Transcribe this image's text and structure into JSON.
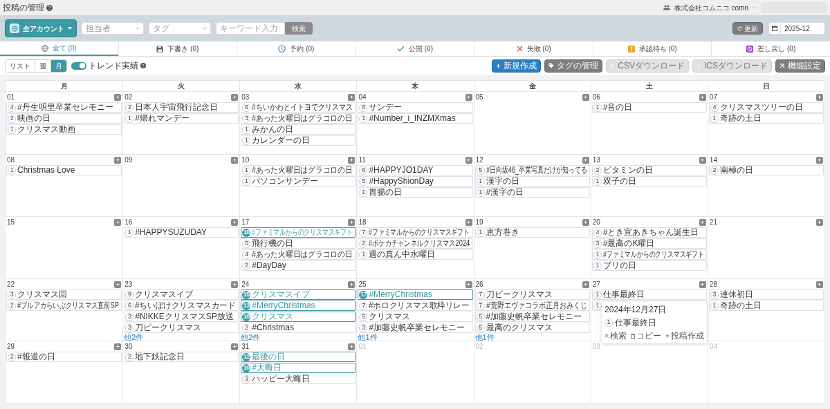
{
  "header": {
    "title": "投稿の管理",
    "company": "株式会社コムニコ comn"
  },
  "toolbar": {
    "account_button": "全アカウント",
    "filters": [
      {
        "placeholder": "担当者"
      },
      {
        "placeholder": "タグ"
      }
    ],
    "keyword": {
      "placeholder": "キーワード入力"
    },
    "search_button": "検索",
    "refresh_button": "更新",
    "month": {
      "value": "2025-12"
    }
  },
  "tabs": [
    {
      "kind": "all",
      "label": "全て (0)",
      "selected": true
    },
    {
      "kind": "draft",
      "label": "下書き (0)",
      "selected": false
    },
    {
      "kind": "scheduled",
      "label": "予約 (0)",
      "selected": false
    },
    {
      "kind": "published",
      "label": "公開 (0)",
      "selected": false
    },
    {
      "kind": "failed",
      "label": "失敗 (0)",
      "selected": false
    },
    {
      "kind": "pending",
      "label": "承認待ち (0)",
      "selected": false
    },
    {
      "kind": "returned",
      "label": "差し戻し (0)",
      "selected": false
    }
  ],
  "views": [
    {
      "label": "リスト",
      "selected": false
    },
    {
      "label": "週",
      "selected": false
    },
    {
      "label": "月",
      "selected": true
    }
  ],
  "trend_toggle": {
    "label": "トレンド実績",
    "on": true
  },
  "actions": [
    {
      "kind": "new",
      "label": "新規作成",
      "disabled": false
    },
    {
      "kind": "tag",
      "label": "タグの管理",
      "disabled": false
    },
    {
      "kind": "download",
      "label": "CSVダウンロード",
      "disabled": true
    },
    {
      "kind": "download",
      "label": "ICSダウンロード",
      "disabled": true
    },
    {
      "kind": "settings",
      "label": "機能設定",
      "disabled": false
    }
  ],
  "calendar": {
    "weekdays": [
      "月",
      "火",
      "水",
      "木",
      "金",
      "土",
      "日"
    ],
    "weeks": [
      [
        {
          "day": "01",
          "other_month": false,
          "items": [
            {
              "count": "4",
              "label": "#丹生明里卒業セレモニー",
              "highlighted": false
            },
            {
              "count": "2",
              "label": "映画の日",
              "highlighted": false
            },
            {
              "count": "1",
              "label": "クリスマス動画",
              "highlighted": false
            }
          ]
        },
        {
          "day": "02",
          "other_month": false,
          "items": [
            {
              "count": "2",
              "label": "日本人宇宙飛行記念日",
              "highlighted": false
            },
            {
              "count": "1",
              "label": "#帰れマンデー",
              "highlighted": false
            }
          ]
        },
        {
          "day": "03",
          "other_month": false,
          "items": [
            {
              "count": "6",
              "label": "#ちいかわとイトヨでクリスマス",
              "highlighted": false
            },
            {
              "count": "3",
              "label": "#あった火曜日はグラコロの日",
              "highlighted": false
            },
            {
              "count": "1",
              "label": "みかんの日",
              "highlighted": false
            },
            {
              "count": "1",
              "label": "カレンダーの日",
              "highlighted": false
            }
          ]
        },
        {
          "day": "04",
          "other_month": false,
          "items": [
            {
              "count": "8",
              "label": "サンデー",
              "highlighted": false
            },
            {
              "count": "1",
              "label": "#Number_i_INZMXmas",
              "highlighted": false
            }
          ]
        },
        {
          "day": "05",
          "other_month": false
        },
        {
          "day": "06",
          "other_month": false,
          "items": [
            {
              "count": "1",
              "label": "#音の日",
              "highlighted": false
            }
          ]
        },
        {
          "day": "07",
          "other_month": false,
          "items": [
            {
              "count": "4",
              "label": "クリスマスツリーの日",
              "highlighted": false
            },
            {
              "count": "1",
              "label": "奇跡の土日",
              "highlighted": false
            }
          ]
        }
      ],
      [
        {
          "day": "08",
          "other_month": false,
          "items": [
            {
              "count": "1",
              "label": "Christmas Love",
              "highlighted": false
            }
          ]
        },
        {
          "day": "09",
          "other_month": false
        },
        {
          "day": "10",
          "other_month": false,
          "items": [
            {
              "count": "1",
              "label": "#あった火曜日はグラコロの日",
              "highlighted": false
            },
            {
              "count": "1",
              "label": "パソコンサンデー",
              "highlighted": false
            }
          ]
        },
        {
          "day": "11",
          "other_month": false,
          "items": [
            {
              "count": "6",
              "label": "#HAPPYJO1DAY",
              "highlighted": false
            },
            {
              "count": "5",
              "label": "#HappyShionDay",
              "highlighted": false
            },
            {
              "count": "1",
              "label": "胃腸の日",
              "highlighted": false
            }
          ]
        },
        {
          "day": "12",
          "other_month": false,
          "items": [
            {
              "count": "5",
              "label": "#日向坂46_卒業写真だけが知ってる",
              "highlighted": false
            },
            {
              "count": "1",
              "label": "漢字の日",
              "highlighted": false
            },
            {
              "count": "1",
              "label": "#漢字の日",
              "highlighted": false
            }
          ]
        },
        {
          "day": "13",
          "other_month": false,
          "items": [
            {
              "count": "2",
              "label": "ビタミンの日",
              "highlighted": false
            },
            {
              "count": "1",
              "label": "双子の日",
              "highlighted": false
            }
          ]
        },
        {
          "day": "14",
          "other_month": false,
          "items": [
            {
              "count": "2",
              "label": "南極の日",
              "highlighted": false
            }
          ]
        }
      ],
      [
        {
          "day": "15",
          "other_month": false
        },
        {
          "day": "16",
          "other_month": false,
          "items": [
            {
              "count": "1",
              "label": "#HAPPYSUZUDAY",
              "highlighted": false
            }
          ]
        },
        {
          "day": "17",
          "other_month": false,
          "items": [
            {
              "count": "10",
              "label": "#ファミマルからのクリスマスギフト",
              "highlighted": true
            },
            {
              "count": "5",
              "label": "飛行機の日",
              "highlighted": false
            },
            {
              "count": "4",
              "label": "#あった火曜日はグラコロの日",
              "highlighted": false
            },
            {
              "count": "2",
              "label": "#DayDay",
              "highlighted": false
            }
          ]
        },
        {
          "day": "18",
          "other_month": false,
          "items": [
            {
              "count": "7",
              "label": "#ファミマルからのクリスマスギフト",
              "highlighted": false
            },
            {
              "count": "2",
              "label": "#ポケカチャンネルクリスマス2024",
              "highlighted": false
            },
            {
              "count": "1",
              "label": "週の真ん中水曜日",
              "highlighted": false
            }
          ]
        },
        {
          "day": "19",
          "other_month": false,
          "items": [
            {
              "count": "1",
              "label": "恵方巻き",
              "highlighted": false
            }
          ]
        },
        {
          "day": "20",
          "other_month": false,
          "items": [
            {
              "count": "4",
              "label": "#とき宣あきちゃん誕生日",
              "highlighted": false
            },
            {
              "count": "3",
              "label": "#最高のK曜日",
              "highlighted": false
            },
            {
              "count": "1",
              "label": "#ファミマルからのクリスマスギフト",
              "highlighted": false
            },
            {
              "count": "1",
              "label": "ブリの日",
              "highlighted": false
            }
          ]
        },
        {
          "day": "21",
          "other_month": false
        }
      ],
      [
        {
          "day": "22",
          "other_month": false,
          "items": [
            {
              "count": "3",
              "label": "クリスマス回",
              "highlighted": false
            },
            {
              "count": "2",
              "label": "#ブルアカらいぶクリスマス直前SP",
              "highlighted": false
            }
          ]
        },
        {
          "day": "23",
          "other_month": false,
          "items": [
            {
              "count": "9",
              "label": "クリスマスイブ",
              "highlighted": false
            },
            {
              "count": "6",
              "label": "#ちいぽけクリスマスカード",
              "highlighted": false
            },
            {
              "count": "3",
              "label": "#NIKKEクリスマスSP放送",
              "highlighted": false
            },
            {
              "count": "3",
              "label": "刀ピークリスマス",
              "highlighted": false
            }
          ],
          "more": "他2件"
        },
        {
          "day": "24",
          "other_month": false,
          "items": [
            {
              "count": "15",
              "label": "クリスマスイブ",
              "highlighted": true
            },
            {
              "count": "13",
              "label": "#MerryChristmas",
              "highlighted": true
            },
            {
              "count": "10",
              "label": "クリスマス",
              "highlighted": true
            },
            {
              "count": "2",
              "label": "#Christmas",
              "highlighted": false
            }
          ],
          "more": "他2件"
        },
        {
          "day": "25",
          "other_month": false,
          "items": [
            {
              "count": "17",
              "label": "#MerryChristmas",
              "highlighted": true
            },
            {
              "count": "7",
              "label": "#ホロクリスマス歌枠リレー",
              "highlighted": false
            },
            {
              "count": "5",
              "label": "クリスマス",
              "highlighted": false
            },
            {
              "count": "3",
              "label": "#加藤史帆卒業セレモニー",
              "highlighted": false
            }
          ],
          "more": "他1件"
        },
        {
          "day": "26",
          "other_month": false,
          "items": [
            {
              "count": "7",
              "label": "刀ピークリスマス",
              "highlighted": false
            },
            {
              "count": "7",
              "label": "#荒野エヴァコラボ正月おみくじ",
              "highlighted": false
            },
            {
              "count": "5",
              "label": "#加藤史帆卒業セレモニー",
              "highlighted": false
            },
            {
              "count": "5",
              "label": "最高のクリスマス",
              "highlighted": false
            }
          ],
          "more": "他1件"
        },
        {
          "day": "27",
          "other_month": false,
          "items": [
            {
              "count": "1",
              "label": "仕事最終日",
              "highlighted": false
            },
            {
              "count": "1",
              "highlighted": false
            }
          ]
        },
        {
          "day": "28",
          "other_month": false,
          "items": [
            {
              "count": "3",
              "label": "連休初日",
              "highlighted": false
            },
            {
              "count": "1",
              "label": "奇跡の土日",
              "highlighted": false
            }
          ]
        }
      ],
      [
        {
          "day": "29",
          "other_month": false,
          "items": [
            {
              "count": "2",
              "label": "#報道の日",
              "highlighted": false
            }
          ]
        },
        {
          "day": "30",
          "other_month": false,
          "items": [
            {
              "count": "2",
              "label": "地下鉄記念日",
              "highlighted": false
            }
          ]
        },
        {
          "day": "31",
          "other_month": false,
          "items": [
            {
              "count": "12",
              "label": "最後の日",
              "highlighted": true
            },
            {
              "count": "10",
              "label": "#大晦日",
              "highlighted": true
            },
            {
              "count": "3",
              "label": "ハッピー大晦日",
              "highlighted": false
            }
          ]
        },
        {
          "day": "01",
          "other_month": true
        },
        {
          "day": "02",
          "other_month": true
        },
        {
          "day": "03",
          "other_month": true
        },
        {
          "day": "04",
          "other_month": true
        }
      ]
    ]
  },
  "popover": {
    "date": "2024年12月27日",
    "count": "1",
    "label": "仕事最終日",
    "actions": [
      {
        "kind": "x",
        "label": "検索"
      },
      {
        "kind": "copy",
        "label": "コピー"
      },
      {
        "kind": "plus",
        "label": "投稿作成"
      }
    ]
  }
}
